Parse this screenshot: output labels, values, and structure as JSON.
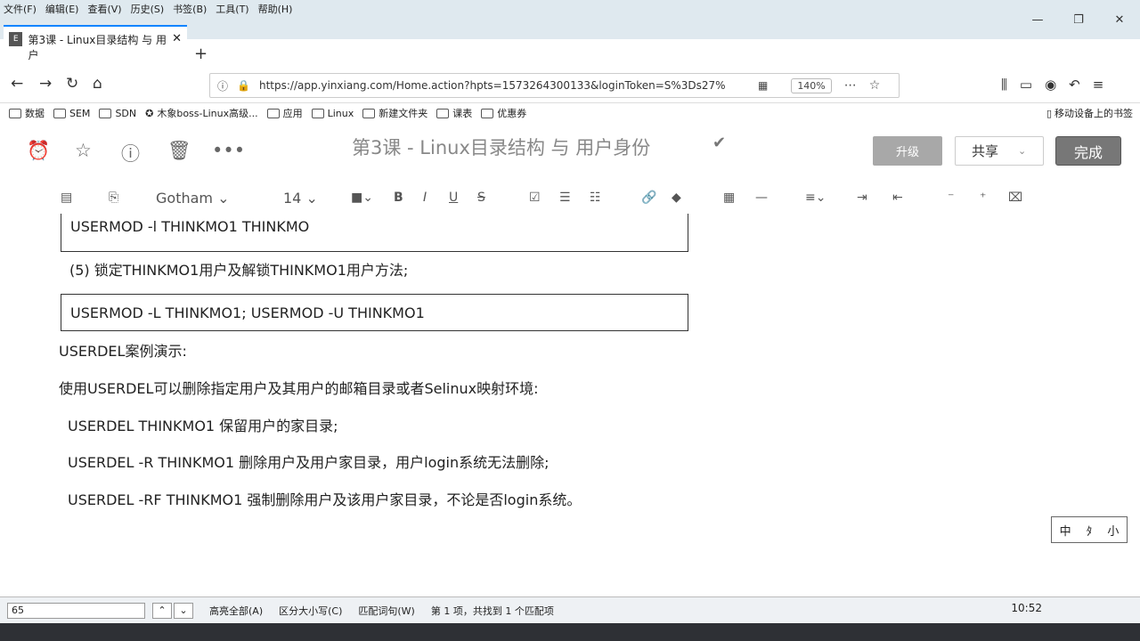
{
  "menu": [
    "文件(F)",
    "编辑(E)",
    "查看(V)",
    "历史(S)",
    "书签(B)",
    "工具(T)",
    "帮助(H)"
  ],
  "window_controls": [
    "—",
    "❐",
    "✕"
  ],
  "tab": {
    "title": "第3课 - Linux目录结构 与 用户",
    "close": "✕",
    "new_tab": "+"
  },
  "nav": {
    "back": "←",
    "forward": "→",
    "reload": "↻",
    "home": "⌂"
  },
  "address": {
    "url": "https://app.yinxiang.com/Home.action?hpts=1573264300133&loginToken=S%3Ds27%",
    "zoom": "140%"
  },
  "bookmarks": [
    "数据",
    "SEM",
    "SDN",
    "木象boss-Linux高级...",
    "应用",
    "Linux",
    "新建文件夹",
    "课表",
    "优惠券"
  ],
  "mobile_bookmarks": "移动设备上的书签",
  "note": {
    "title": "第3课 - Linux目录结构 与 用户身份",
    "upgrade": "升级",
    "share": "共享",
    "done": "完成"
  },
  "format": {
    "font": "Gotham",
    "size": "14"
  },
  "content": {
    "box1": "USERMOD -l THINKMO1 THINKMO",
    "item5": "(5)       锁定THINKMO1用户及解锁THINKMO1用户方法;",
    "box2": "USERMOD -L THINKMO1;  USERMOD   -U THINKMO1",
    "heading": "USERDEL案例演示:",
    "desc": "使用USERDEL可以删除指定用户及其用户的邮箱目录或者Selinux映射环境:",
    "l1": "USERDEL   THINKMO1 保留用户的家目录;",
    "l2": "USERDEL -R THINKMO1 删除用户及用户家目录，用户login系统无法删除;",
    "l3": "USERDEL -RF THINKMO1 强制删除用户及该用户家目录，不论是否login系统。"
  },
  "ime": [
    "中",
    "ﾀ",
    "小"
  ],
  "findbar": {
    "input": "65",
    "highlight_all": "高亮全部(A)",
    "match_case": "区分大小写(C)",
    "whole_words": "匹配词句(W)",
    "result": "第 1 项，共找到 1 个匹配项"
  },
  "clock": "10:52"
}
